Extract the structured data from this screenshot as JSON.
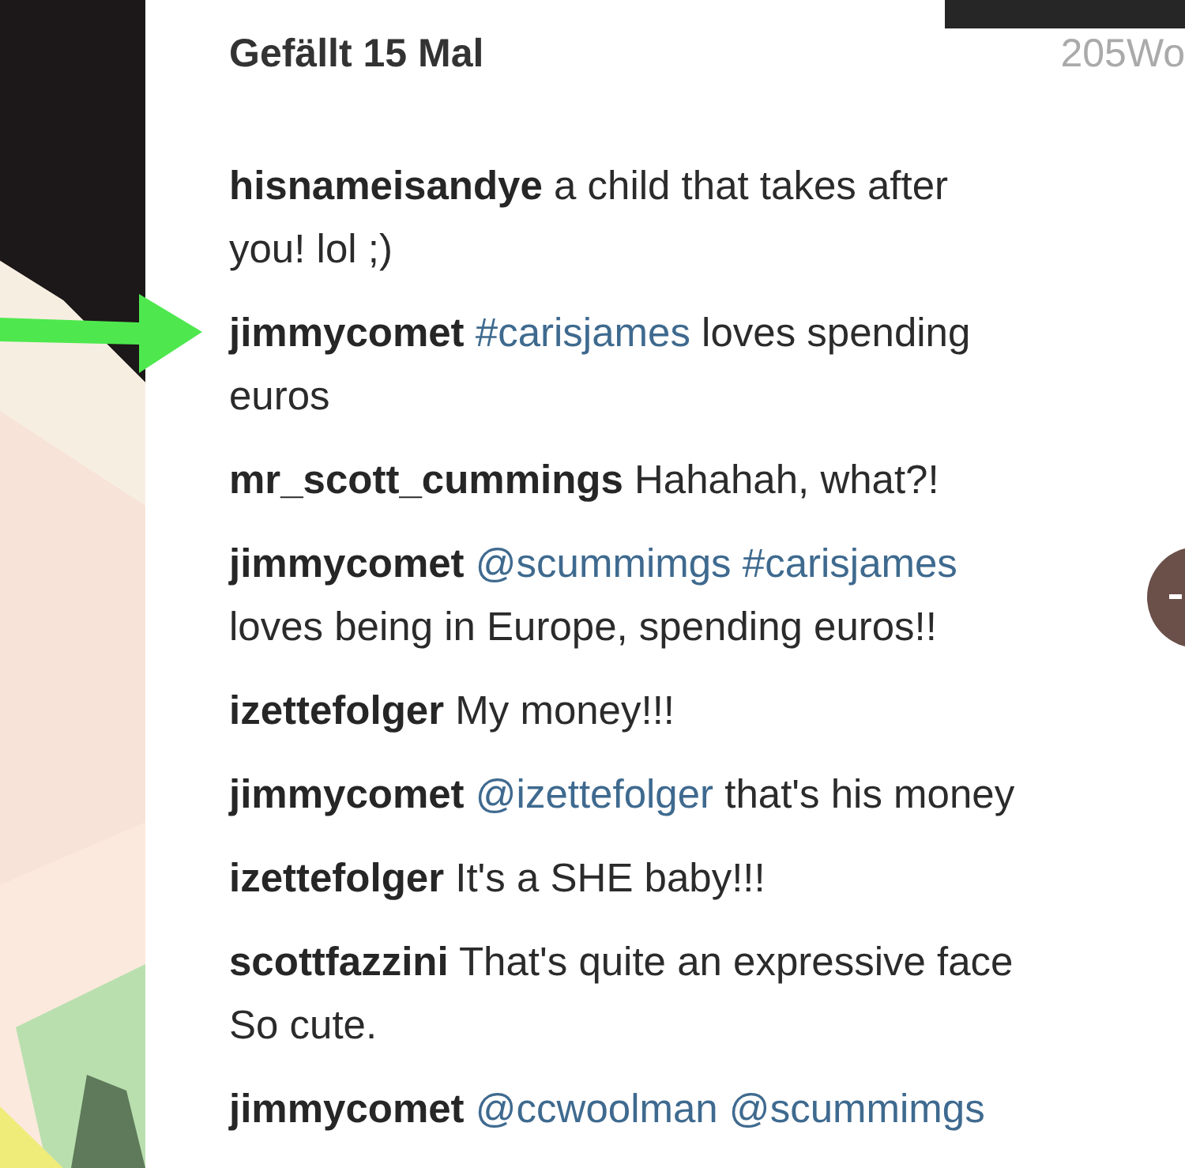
{
  "likes": "Gefällt 15 Mal",
  "time": "205Wo",
  "comments": [
    {
      "user": "hisnameisandye",
      "lines": [
        [
          {
            "kind": "text",
            "text": "a child that takes after"
          }
        ],
        [
          {
            "kind": "text",
            "text": "you! lol ;)"
          }
        ]
      ]
    },
    {
      "user": "jimmycomet",
      "lines": [
        [
          {
            "kind": "tag",
            "text": "#carisjames"
          },
          {
            "kind": "text",
            "text": " loves spending"
          }
        ],
        [
          {
            "kind": "text",
            "text": "euros"
          }
        ]
      ]
    },
    {
      "user": "mr_scott_cummings",
      "lines": [
        [
          {
            "kind": "text",
            "text": "Hahahah, what?!"
          }
        ]
      ]
    },
    {
      "user": "jimmycomet",
      "lines": [
        [
          {
            "kind": "tag",
            "text": "@scummimgs"
          },
          {
            "kind": "tag",
            "text": " #carisjames"
          }
        ],
        [
          {
            "kind": "text",
            "text": "loves being in Europe, spending euros!!"
          }
        ]
      ]
    },
    {
      "user": "izettefolger",
      "lines": [
        [
          {
            "kind": "text",
            "text": "My money!!!"
          }
        ]
      ]
    },
    {
      "user": "jimmycomet",
      "lines": [
        [
          {
            "kind": "tag",
            "text": "@izettefolger"
          },
          {
            "kind": "text",
            "text": " that's his money"
          }
        ]
      ]
    },
    {
      "user": "izettefolger",
      "lines": [
        [
          {
            "kind": "text",
            "text": "It's a SHE baby!!!"
          }
        ]
      ]
    },
    {
      "user": "scottfazzini",
      "lines": [
        [
          {
            "kind": "text",
            "text": "That's quite an expressive face"
          }
        ],
        [
          {
            "kind": "text",
            "text": "So cute."
          }
        ]
      ]
    },
    {
      "user": "jimmycomet",
      "lines": [
        [
          {
            "kind": "tag",
            "text": "@ccwoolman"
          },
          {
            "kind": "tag",
            "text": " @scummimgs"
          }
        ]
      ]
    }
  ]
}
